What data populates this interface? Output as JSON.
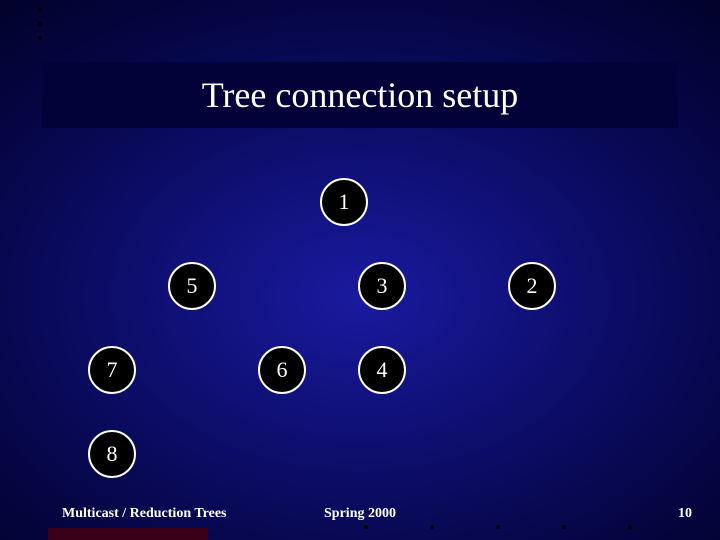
{
  "title": "Tree connection setup",
  "nodes": {
    "n1": "1",
    "n5": "5",
    "n3": "3",
    "n2": "2",
    "n7": "7",
    "n6": "6",
    "n4": "4",
    "n8": "8"
  },
  "footer": {
    "left": "Multicast / Reduction Trees",
    "center": "Spring 2000",
    "right": "10"
  }
}
